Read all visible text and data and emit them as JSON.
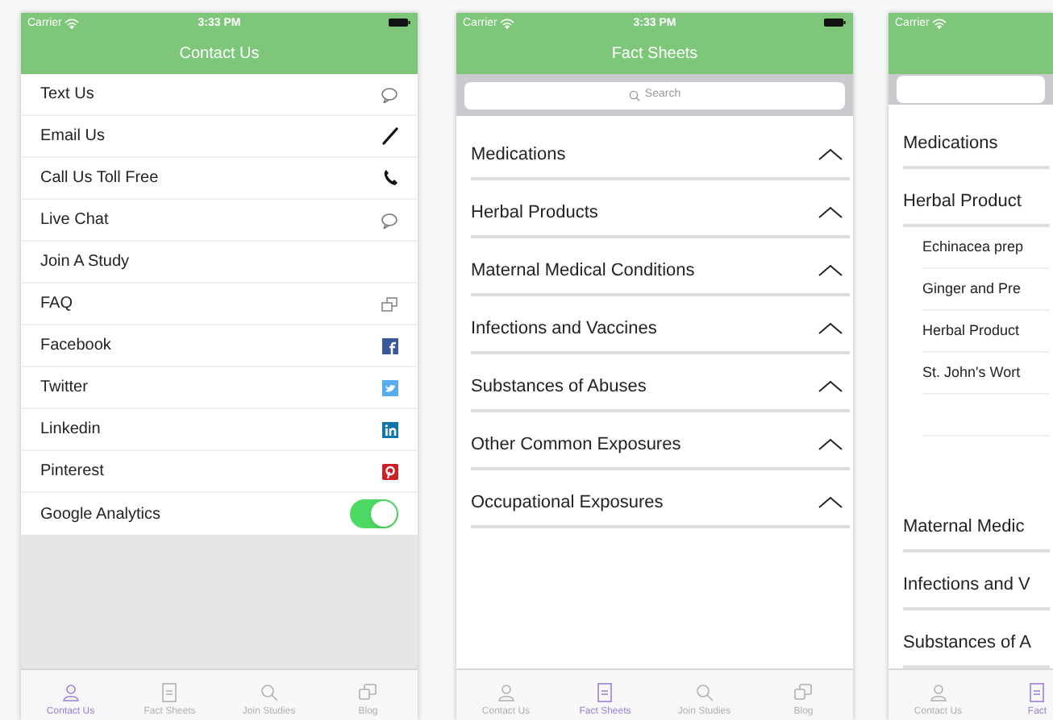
{
  "screens": [
    {
      "kind": "contact",
      "status_bar": {
        "carrier": "Carrier",
        "time": "3:33 PM"
      },
      "title": "Contact Us",
      "items": [
        {
          "label": "Text Us",
          "kind": "link"
        },
        {
          "label": "Email Us",
          "kind": "link"
        },
        {
          "label": "Call Us Toll Free",
          "kind": "link"
        },
        {
          "label": "Live Chat",
          "kind": "link"
        },
        {
          "label": "Join A Study",
          "kind": "link"
        },
        {
          "label": "FAQ",
          "kind": "link"
        },
        {
          "label": "Facebook",
          "kind": "link"
        },
        {
          "label": "Twitter",
          "kind": "link"
        },
        {
          "label": "Linkedin",
          "kind": "link"
        },
        {
          "label": "Pinterest",
          "kind": "link"
        },
        {
          "label": "Google Analytics",
          "kind": "toggle",
          "on": true
        }
      ],
      "tabs": [
        {
          "label": "Contact Us",
          "selected": true
        },
        {
          "label": "Fact Sheets",
          "selected": false
        },
        {
          "label": "Join Studies",
          "selected": false
        },
        {
          "label": "Blog",
          "selected": false
        }
      ]
    },
    {
      "kind": "sheets",
      "status_bar": {
        "carrier": "Carrier",
        "time": "3:33 PM"
      },
      "title": "Fact Sheets",
      "search": {
        "placeholder": "Search"
      },
      "sections": [
        {
          "label": "Medications",
          "expanded": false
        },
        {
          "label": "Herbal Products",
          "expanded": false
        },
        {
          "label": "Maternal Medical Conditions",
          "expanded": false
        },
        {
          "label": "Infections and Vaccines",
          "expanded": false
        },
        {
          "label": "Substances of Abuses",
          "expanded": false
        },
        {
          "label": "Other Common Exposures",
          "expanded": false
        },
        {
          "label": "Occupational Exposures",
          "expanded": false
        }
      ],
      "tabs": [
        {
          "label": "Contact Us",
          "selected": false
        },
        {
          "label": "Fact Sheets",
          "selected": true
        },
        {
          "label": "Join Studies",
          "selected": false
        },
        {
          "label": "Blog",
          "selected": false
        }
      ]
    },
    {
      "kind": "sheets_cut",
      "status_bar": {
        "carrier": "Carrier"
      },
      "sections": [
        {
          "label": "Medications"
        },
        {
          "label": "Herbal Product",
          "children": [
            {
              "label": "Echinacea prep"
            },
            {
              "label": "Ginger and Pre"
            },
            {
              "label": "Herbal Product"
            },
            {
              "label": "St. John's Wort"
            }
          ]
        },
        {
          "label": "Maternal Medic"
        },
        {
          "label": "Infections and V"
        },
        {
          "label": "Substances of A"
        }
      ],
      "tabs": [
        {
          "label": "Contact Us",
          "selected": false
        },
        {
          "label": "Fact",
          "selected": true
        }
      ]
    }
  ]
}
